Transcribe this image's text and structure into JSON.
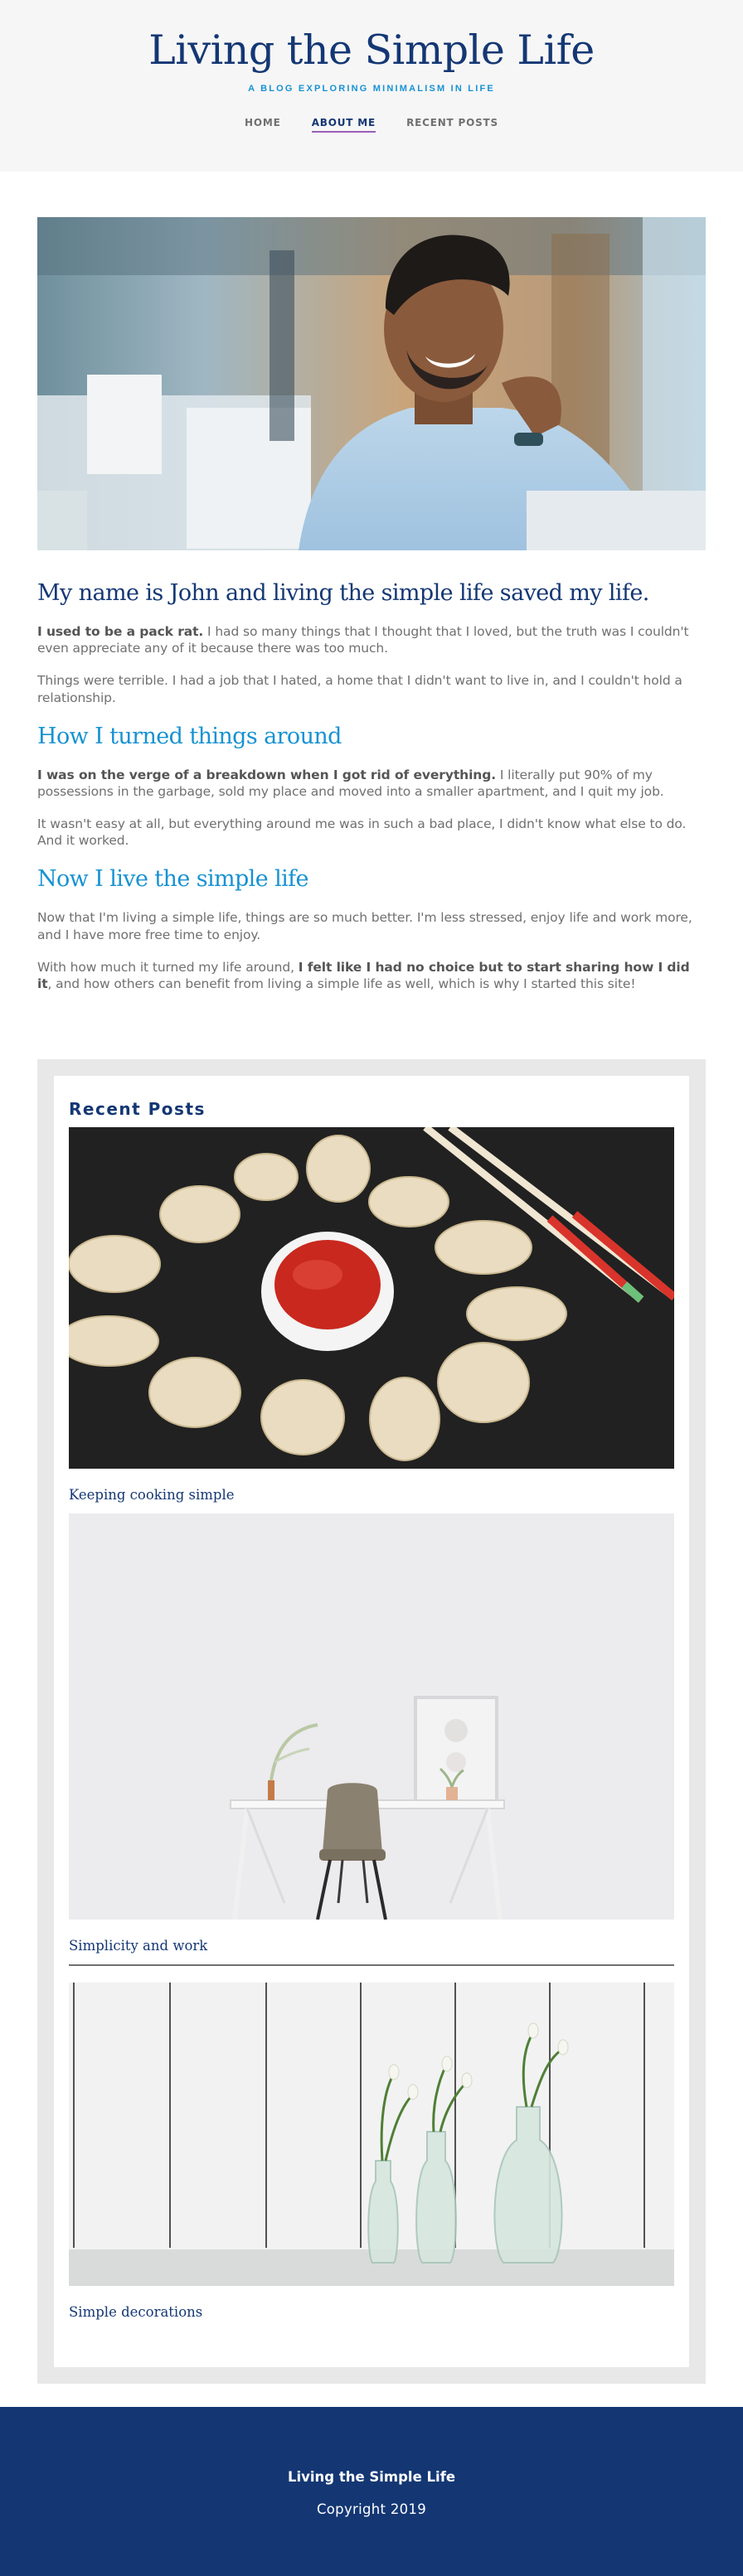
{
  "header": {
    "site_title": "Living the Simple Life",
    "tagline": "A BLOG EXPLORING MINIMALISM IN LIFE",
    "nav": [
      {
        "label": "HOME",
        "active": false
      },
      {
        "label": "ABOUT ME",
        "active": true
      },
      {
        "label": "RECENT POSTS",
        "active": false
      }
    ]
  },
  "article": {
    "title": "My name is John and living the simple life saved my life.",
    "p1_strong": "I used to be a pack rat.",
    "p1_rest": " I had so many things that I thought that I loved, but the truth was I couldn't even appreciate any of it because there was too much.",
    "p2": "Things were terrible. I had a job that I hated, a home that I didn't want to live in, and I couldn't hold a relationship.",
    "h2_1": "How I turned things around",
    "p3_strong": "I was on the verge of a breakdown when I got rid of everything.",
    "p3_rest": " I literally put 90% of my possessions in the garbage, sold my place and moved into a smaller apartment, and I quit my job.",
    "p4": "It wasn't easy at all, but everything around me was in such a bad place, I didn't know what else to do. And it worked.",
    "h2_2": "Now I live the simple life",
    "p5": "Now that I'm living a simple life, things are so much better. I'm less stressed, enjoy life and work more, and I have more free time to enjoy.",
    "p6_pre": "With how much it turned my life around, ",
    "p6_strong": "I felt like I had no choice but to start sharing how I did it",
    "p6_rest": ", and how others can benefit from living a simple life as well, which is why I started this site!"
  },
  "sidebar": {
    "widget_title": "Recent Posts",
    "posts": [
      {
        "title": "Keeping cooking simple"
      },
      {
        "title": "Simplicity and work"
      },
      {
        "title": "Simple decorations"
      }
    ]
  },
  "footer": {
    "name": "Living the Simple Life",
    "copyright": "Copyright 2019"
  },
  "colors": {
    "primary": "#143774",
    "accent": "#1792d2",
    "nav_underline": "#9a5fb5",
    "text": "#707070",
    "header_bg": "#f6f6f6"
  }
}
